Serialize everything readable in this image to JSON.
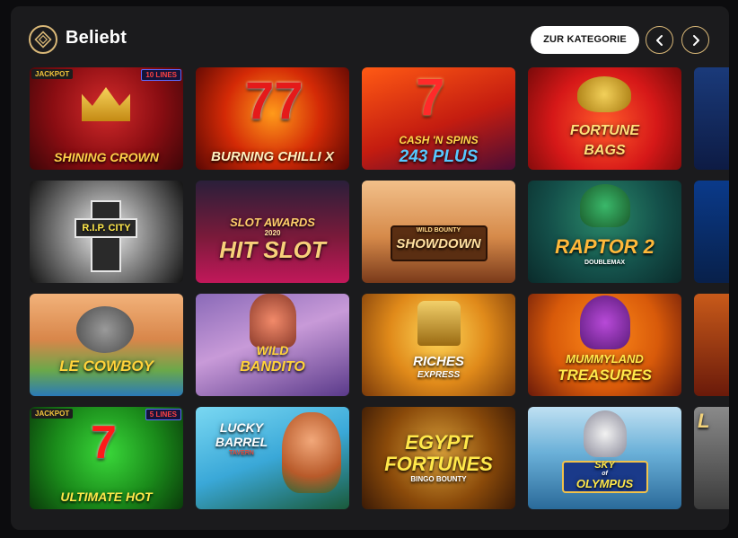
{
  "header": {
    "title": "Beliebt",
    "category_button": "ZUR KATEGORIE",
    "prev_icon": "chevron-left-icon",
    "next_icon": "chevron-right-icon",
    "accent_color": "#d8b777"
  },
  "games": [
    {
      "id": "shining-crown",
      "title": "SHINING CROWN",
      "badge": "JACKPOT",
      "lines": "10 LINES"
    },
    {
      "id": "burning-chilli-x",
      "title": "BURNING CHILLI X"
    },
    {
      "id": "cash-n-spins",
      "title": "CASH 'N SPINS",
      "subtitle": "243 PLUS"
    },
    {
      "id": "fortune-bags",
      "title": "FORTUNE",
      "subtitle": "BAGS"
    },
    {
      "id": "partial-1",
      "title": ""
    },
    {
      "id": "rip-city",
      "title": "R.I.P. CITY"
    },
    {
      "id": "hit-slot",
      "title": "SLOT AWARDS",
      "subtitle": "HIT SLOT",
      "year": "2020"
    },
    {
      "id": "showdown",
      "title": "SHOWDOWN",
      "tagline": "WILD BOUNTY"
    },
    {
      "id": "raptor-2",
      "title": "RAPTOR 2",
      "tagline": "DOUBLEMAX"
    },
    {
      "id": "partial-2",
      "title": ""
    },
    {
      "id": "le-cowboy",
      "title": "LE COWBOY"
    },
    {
      "id": "wild-bandito",
      "title": "WILD",
      "subtitle": "BANDITO"
    },
    {
      "id": "riches-express",
      "title": "RICHES",
      "subtitle": "EXPRESS"
    },
    {
      "id": "mummyland",
      "title": "MUMMYLAND",
      "subtitle": "TREASURES"
    },
    {
      "id": "partial-3",
      "title": ""
    },
    {
      "id": "ultimate-hot",
      "title": "ULTIMATE HOT",
      "badge": "JACKPOT",
      "lines": "5 LINES"
    },
    {
      "id": "lucky-barrel",
      "title": "LUCKY",
      "subtitle": "BARREL",
      "tagline": "TAVERN"
    },
    {
      "id": "egypt-fortunes",
      "title": "EGYPT",
      "subtitle": "FORTUNES",
      "tagline": "BINGO BOUNTY"
    },
    {
      "id": "sky-of-olympus",
      "title": "SKY",
      "subtitle": "OLYMPUS",
      "tagline": "of"
    },
    {
      "id": "partial-4",
      "title": "L"
    }
  ]
}
